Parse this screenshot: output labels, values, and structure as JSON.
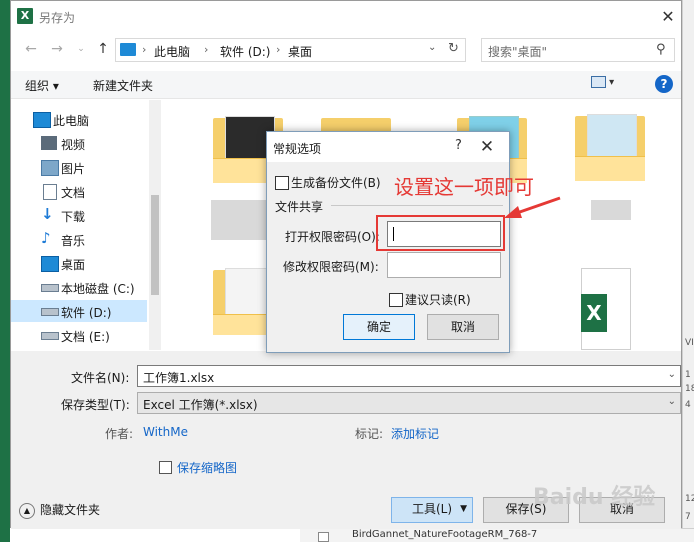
{
  "window": {
    "title": "另存为",
    "app_icon": "X"
  },
  "address_bar": {
    "crumbs": [
      "此电脑",
      "软件 (D:)",
      "桌面"
    ]
  },
  "search": {
    "placeholder": "搜索\"桌面\""
  },
  "toolbar": {
    "organize": "组织 ▾",
    "new_folder": "新建文件夹",
    "help": "?"
  },
  "sidebar": {
    "items": [
      {
        "label": "此电脑",
        "icon": "computer-icon"
      },
      {
        "label": "视频",
        "icon": "video-icon"
      },
      {
        "label": "图片",
        "icon": "picture-icon"
      },
      {
        "label": "文档",
        "icon": "document-icon"
      },
      {
        "label": "下载",
        "icon": "download-icon"
      },
      {
        "label": "音乐",
        "icon": "music-icon"
      },
      {
        "label": "桌面",
        "icon": "desktop-icon"
      },
      {
        "label": "本地磁盘 (C:)",
        "icon": "drive-icon"
      },
      {
        "label": "软件 (D:)",
        "icon": "drive-icon",
        "selected": true
      },
      {
        "label": "文档 (E:)",
        "icon": "drive-icon"
      }
    ]
  },
  "form": {
    "filename_label": "文件名(N):",
    "filename_value": "工作簿1.xlsx",
    "filetype_label": "保存类型(T):",
    "filetype_value": "Excel 工作簿(*.xlsx)",
    "author_label": "作者:",
    "author_value": "WithMe",
    "tags_label": "标记:",
    "tags_value": "添加标记",
    "thumbnail_label": "保存缩略图",
    "hide_folders": "隐藏文件夹",
    "tools_button": "工具(L)",
    "save_button": "保存(S)",
    "cancel_button": "取消"
  },
  "options_dialog": {
    "title": "常规选项",
    "help": "?",
    "backup_label": "生成备份文件(B)",
    "file_sharing_label": "文件共享",
    "open_password_label": "打开权限密码(O):",
    "modify_password_label": "修改权限密码(M):",
    "readonly_label": "建议只读(R)",
    "ok_button": "确定",
    "cancel_button": "取消"
  },
  "annotation": {
    "text": "设置这一项即可",
    "color": "#e53935"
  },
  "watermark": "Baidu 经验",
  "background": {
    "taskbar_item": "BirdGannet_NatureFootageRM_768-7",
    "right_edge_texts": [
      "VI",
      "1",
      "18",
      "4",
      "12",
      "7"
    ]
  },
  "colors": {
    "excel_green": "#1e7145",
    "link_blue": "#1466c8",
    "accent": "#0078d7",
    "selection": "#cce8ff"
  }
}
